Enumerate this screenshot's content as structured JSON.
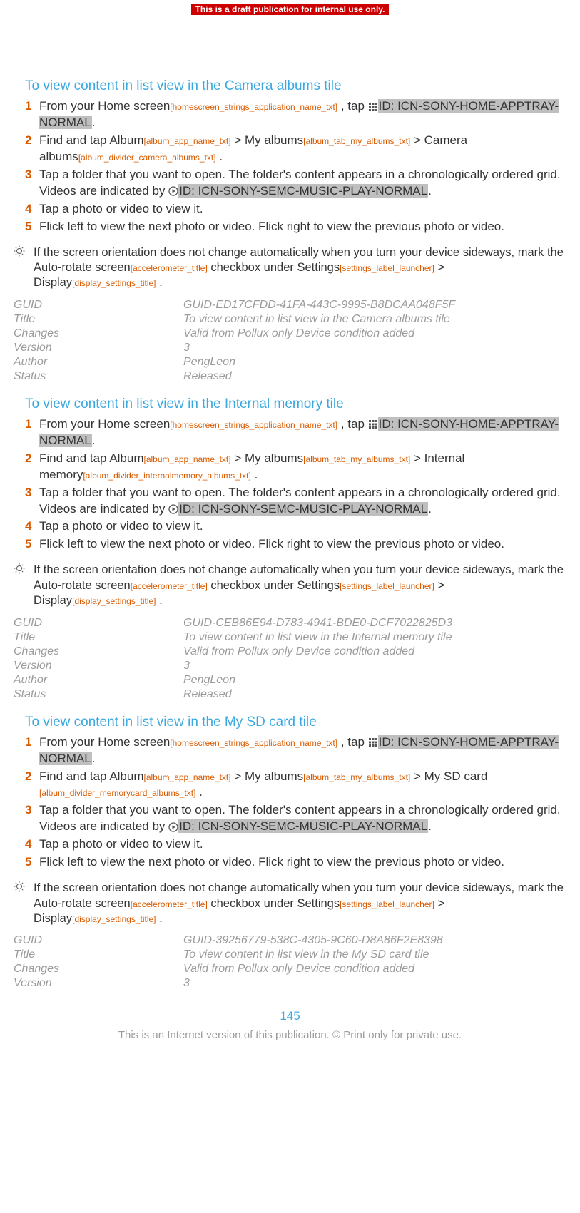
{
  "banner": "This is a draft publication for internal use only.",
  "common": {
    "home_screen": "Home screen",
    "home_screen_tag": "[homescreen_strings_application_name_txt]",
    "tap_prefix": "From your ",
    "tap_mid": " , tap ",
    "id_apptray": "ID: ICN-SONY-HOME-APPTRAY-NORMAL",
    "period": ".",
    "find_prefix": "Find and tap ",
    "album": "Album",
    "album_tag": "[album_app_name_txt]",
    "gt": " > ",
    "my_albums": "My albums",
    "my_albums_tag": "[album_tab_my_albums_txt]",
    "step3a": "Tap a folder that you want to open. The folder's content appears in a chronologically ordered grid. Videos are indicated by ",
    "id_music": "ID: ICN-SONY-SEMC-MUSIC-PLAY-NORMAL",
    "step4": "Tap a photo or video to view it.",
    "step5": "Flick left to view the next photo or video. Flick right to view the previous photo or video.",
    "tip_a": "If the screen orientation does not change automatically when you turn your device sideways, mark the ",
    "auto_rotate": "Auto-rotate screen",
    "auto_rotate_tag": "[accelerometer_title]",
    "tip_b": " checkbox under ",
    "settings": "Settings",
    "settings_tag": "[settings_label_launcher]",
    "display": "Display",
    "display_tag": "[display_settings_title]",
    "meta_labels": {
      "guid": "GUID",
      "title": "Title",
      "changes": "Changes",
      "version": "Version",
      "author": "Author",
      "status": "Status"
    }
  },
  "sections": [
    {
      "title": "To view content in list view in the Camera albums tile",
      "target": "Camera albums",
      "target_tag": "[album_divider_camera_albums_txt]",
      "meta": {
        "guid": "GUID-ED17CFDD-41FA-443C-9995-B8DCAA048F5F",
        "title": "To view content in list view in the Camera albums tile",
        "changes": "Valid from Pollux only Device condition added",
        "version": "3",
        "author": "PengLeon",
        "status": "Released"
      }
    },
    {
      "title": "To view content in list view in the Internal memory tile",
      "target": "Internal memory",
      "target_tag": "[album_divider_internalmemory_albums_txt]",
      "meta": {
        "guid": "GUID-CEB86E94-D783-4941-BDE0-DCF7022825D3",
        "title": "To view content in list view in the Internal memory tile",
        "changes": "Valid from Pollux only Device condition added",
        "version": "3",
        "author": "PengLeon",
        "status": "Released"
      }
    },
    {
      "title": "To view content in list view in the My SD card tile",
      "target": "My SD card",
      "target_tag": "[album_divider_memorycard_albums_txt]",
      "meta": {
        "guid": "GUID-39256779-538C-4305-9C60-D8A86F2E8398",
        "title": "To view content in list view in the My SD card tile",
        "changes": "Valid from Pollux only Device condition added",
        "version": "3"
      }
    }
  ],
  "page_number": "145",
  "footer": "This is an Internet version of this publication. © Print only for private use."
}
